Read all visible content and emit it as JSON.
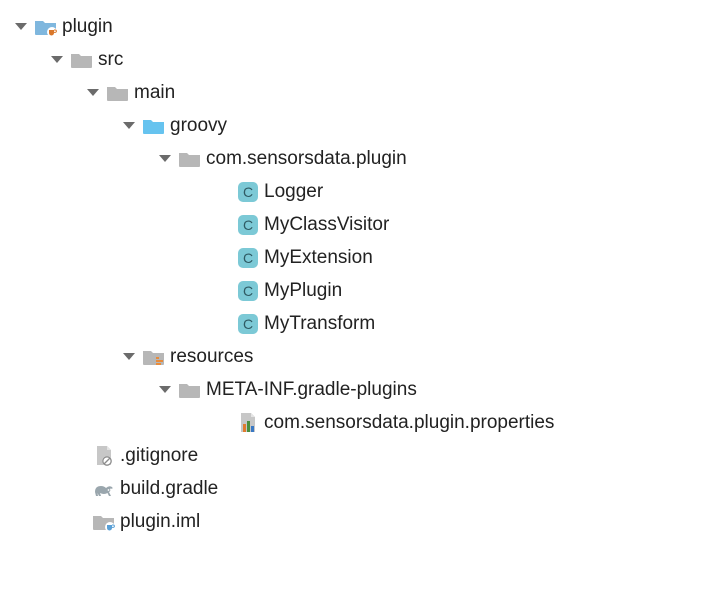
{
  "tree": [
    {
      "indent": 0,
      "arrow": true,
      "icon": "folder-coffee",
      "label": "plugin"
    },
    {
      "indent": 36,
      "arrow": true,
      "icon": "folder-gray",
      "label": "src"
    },
    {
      "indent": 72,
      "arrow": true,
      "icon": "folder-gray",
      "label": "main"
    },
    {
      "indent": 108,
      "arrow": true,
      "icon": "folder-blue",
      "label": "groovy"
    },
    {
      "indent": 144,
      "arrow": true,
      "icon": "folder-gray",
      "label": "com.sensorsdata.plugin"
    },
    {
      "indent": 202,
      "arrow": false,
      "icon": "class",
      "label": "Logger"
    },
    {
      "indent": 202,
      "arrow": false,
      "icon": "class",
      "label": "MyClassVisitor"
    },
    {
      "indent": 202,
      "arrow": false,
      "icon": "class",
      "label": "MyExtension"
    },
    {
      "indent": 202,
      "arrow": false,
      "icon": "class",
      "label": "MyPlugin"
    },
    {
      "indent": 202,
      "arrow": false,
      "icon": "class",
      "label": "MyTransform"
    },
    {
      "indent": 108,
      "arrow": true,
      "icon": "folder-res",
      "label": "resources"
    },
    {
      "indent": 144,
      "arrow": true,
      "icon": "folder-gray",
      "label": "META-INF.gradle-plugins"
    },
    {
      "indent": 202,
      "arrow": false,
      "icon": "properties",
      "label": "com.sensorsdata.plugin.properties"
    },
    {
      "indent": 58,
      "arrow": false,
      "icon": "gitignore",
      "label": ".gitignore"
    },
    {
      "indent": 58,
      "arrow": false,
      "icon": "gradle",
      "label": "build.gradle"
    },
    {
      "indent": 58,
      "arrow": false,
      "icon": "iml",
      "label": "plugin.iml"
    }
  ]
}
